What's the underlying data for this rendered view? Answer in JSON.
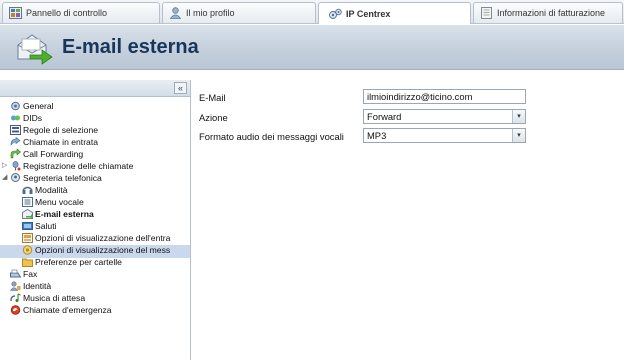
{
  "tabs": [
    {
      "label": "Pannello di controllo",
      "icon": "control-panel-icon"
    },
    {
      "label": "Il mio profilo",
      "icon": "profile-icon"
    },
    {
      "label": "IP Centrex",
      "icon": "ip-centrex-icon"
    },
    {
      "label": "Informazioni di fatturazione",
      "icon": "billing-icon"
    }
  ],
  "header": {
    "title": "E-mail esterna",
    "icon": "email-forward-icon"
  },
  "sidebar": {
    "collapse_label": "«",
    "items": [
      {
        "label": "General",
        "icon": "general-icon"
      },
      {
        "label": "DIDs",
        "icon": "dids-icon"
      },
      {
        "label": "Regole di selezione",
        "icon": "rules-icon"
      },
      {
        "label": "Chiamate in entrata",
        "icon": "incoming-calls-icon"
      },
      {
        "label": "Call Forwarding",
        "icon": "call-forwarding-icon"
      },
      {
        "label": "Registrazione delle chiamate",
        "icon": "call-recording-icon"
      },
      {
        "label": "Segreteria telefonica",
        "icon": "voicemail-icon"
      },
      {
        "label": "Modalità",
        "icon": "mode-icon"
      },
      {
        "label": "Menu vocale",
        "icon": "voice-menu-icon"
      },
      {
        "label": "E-mail esterna",
        "icon": "external-email-icon"
      },
      {
        "label": "Saluti",
        "icon": "greetings-icon"
      },
      {
        "label": "Opzioni di visualizzazione dell'entra",
        "icon": "inbox-view-options-icon"
      },
      {
        "label": "Opzioni di visualizzazione del mess",
        "icon": "message-view-options-icon"
      },
      {
        "label": "Preferenze per cartelle",
        "icon": "folder-preferences-icon"
      },
      {
        "label": "Fax",
        "icon": "fax-icon"
      },
      {
        "label": "Identità",
        "icon": "identity-icon"
      },
      {
        "label": "Musica di attesa",
        "icon": "hold-music-icon"
      },
      {
        "label": "Chiamate d'emergenza",
        "icon": "emergency-calls-icon"
      }
    ]
  },
  "form": {
    "email_label": "E-Mail",
    "email_value": "ilmioindirizzo@ticino.com",
    "action_label": "Azione",
    "action_value": "Forward",
    "audio_label": "Formato audio dei messaggi vocali",
    "audio_value": "MP3"
  },
  "colors": {
    "accent": "#18365c",
    "selection": "#c9d8ec"
  }
}
